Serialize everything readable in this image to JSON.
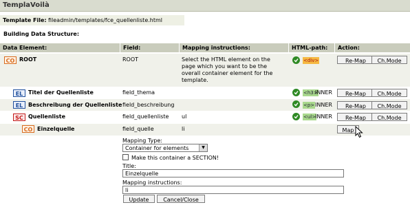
{
  "app_title": "TemplaVoilà",
  "template_file": {
    "label": "Template File:",
    "value": "fileadmin/templates/fce_quellenliste.html"
  },
  "building_label": "Building Data Structure:",
  "columns": {
    "data_element": "Data Element:",
    "field": "Field:",
    "mapping_instructions": "Mapping instructions:",
    "html_path": "HTML-path:",
    "action": "Action:"
  },
  "rows": [
    {
      "badge": "CO",
      "name": "ROOT",
      "field": "ROOT",
      "instructions": "Select the HTML element on the page which you want to be the overall container element for the template.",
      "tag": "<div>",
      "inner": ""
    },
    {
      "badge": "EL",
      "name": "Titel der Quellenliste",
      "field": "field_thema",
      "instructions": "",
      "tag": "<h3>",
      "inner": "INNER"
    },
    {
      "badge": "EL",
      "name": "Beschreibung der Quellenliste",
      "field": "field_beschreibung",
      "instructions": "",
      "tag": "<p>",
      "inner": "INNER"
    },
    {
      "badge": "SC",
      "name": "Quellenliste",
      "field": "field_quellenliste",
      "instructions": "ul",
      "tag": "<ul>",
      "inner": "INNER"
    },
    {
      "badge": "CO",
      "name": "Einzelquelle",
      "field": "field_quelle",
      "instructions": "li",
      "tag": "",
      "inner": ""
    }
  ],
  "buttons": {
    "remap": "Re-Map",
    "chmode": "Ch.Mode",
    "map": "Map"
  },
  "form": {
    "mapping_type_label": "Mapping Type:",
    "mapping_type_value": "Container for elements",
    "section_checkbox_label": "Make this container a SECTION!",
    "section_checked": false,
    "title_label": "Title:",
    "title_value": "Einzelquelle",
    "instructions_label": "Mapping instructions:",
    "instructions_value": "li",
    "update_button": "Update",
    "cancel_button": "Cancel/Close"
  },
  "colors": {
    "header_bg": "#c9ccbc",
    "row_alt_bg": "#f0f1ea",
    "badge_co": "#d86a1c",
    "badge_el": "#1f4f9c",
    "badge_sc": "#c41818",
    "check_green": "#2f8a24"
  }
}
